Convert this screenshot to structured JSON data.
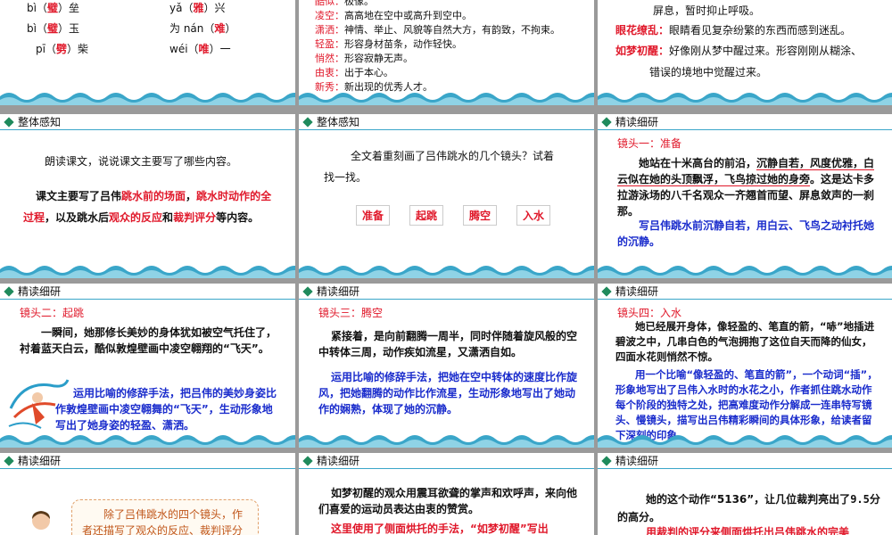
{
  "s1": {
    "rows": [
      {
        "py": "bì",
        "ch": "璧",
        "tail": "垒"
      },
      {
        "py": "bì",
        "ch": "璧",
        "tail": "玉"
      },
      {
        "py": "pī",
        "ch": "劈",
        "tail": "柴"
      }
    ],
    "rows2": [
      {
        "py": "yǎ",
        "ch": "雅",
        "tail": "兴"
      },
      {
        "py": "为 nán",
        "ch": "难",
        "tail": ""
      },
      {
        "py": "wéi",
        "ch": "唯",
        "tail": "一"
      }
    ]
  },
  "s2": {
    "items": [
      {
        "k": "酷似：",
        "v": "极像。"
      },
      {
        "k": "凌空：",
        "v": "高高地在空中或高升到空中。"
      },
      {
        "k": "潇洒：",
        "v": "神情、举止、风貌等自然大方，有韵致，不拘束。"
      },
      {
        "k": "轻盈：",
        "v": "形容身材苗条，动作轻快。"
      },
      {
        "k": "悄然：",
        "v": "形容寂静无声。"
      },
      {
        "k": "由衷：",
        "v": "出于本心。"
      },
      {
        "k": "新秀：",
        "v": "新出现的优秀人才。"
      }
    ]
  },
  "s3": {
    "line0": "屏息，暂时抑止呼吸。",
    "items": [
      {
        "k": "眼花缭乱：",
        "v": "眼睛看见复杂纷繁的东西而感到迷乱。"
      },
      {
        "k": "如梦初醒：",
        "v": "好像刚从梦中醒过来。形容刚刚从糊涂、"
      }
    ],
    "line_last": "错误的境地中觉醒过来。"
  },
  "s4": {
    "header": "整体感知",
    "q": "朗读课文，说说课文主要写了哪些内容。",
    "a_parts": [
      "课文主要写了吕伟",
      "跳水前的场面",
      "，",
      "跳水时动作",
      "的全过程",
      "，以及跳水后",
      "观众的反应",
      "和",
      "裁判评分",
      "等内容。"
    ]
  },
  "s5": {
    "header": "整体感知",
    "q1": "全文着重刻画了吕伟跳水的几个镜头？试着",
    "q2": "找一找。",
    "boxes": [
      "准备",
      "起跳",
      "腾空",
      "入水"
    ]
  },
  "s6": {
    "header": "精读细研",
    "label": "镜头一：准备",
    "p1": "她站在十米高台的前沿，",
    "p1u": "沉静自若，风度优雅，白云似在她的头顶飘浮，飞鸟掠过她的身旁",
    "p1b": "。这是达卡多拉游泳场的八千名观众一齐翘首而望、屏息敛声的一刹那。",
    "a": "写吕伟跳水前沉静自若，用白云、飞鸟之动衬托她的沉静。"
  },
  "s7": {
    "header": "精读细研",
    "label": "镜头二：起跳",
    "p": "一瞬间，她那修长美妙的身体犹如被空气托住了，衬着蓝天白云，酷似敦煌壁画中凌空翱翔的“飞天”。",
    "a": "运用比喻的修辞手法，把吕伟的美妙身姿比作敦煌壁画中凌空翱舞的“飞天”，生动形象地写出了她身姿的轻盈、潇洒。"
  },
  "s8": {
    "header": "精读细研",
    "label": "镜头三：腾空",
    "p": "紧接着，是向前翻腾一周半，同时伴随着旋风般的空中转体三周，动作疾如流星，又潇洒自如。",
    "a": "运用比喻的修辞手法，把她在空中转体的速度比作旋风，把她翻腾的动作比作流星，生动形象地写出了她动作的娴熟，体现了她的沉静。"
  },
  "s9": {
    "header": "精读细研",
    "label": "镜头四：入水",
    "p": "她已经展开身体，像轻盈的、笔直的箭，“哧”地插进碧波之中，几串白色的气泡拥抱了这位自天而降的仙女，四面水花则悄然不惊。",
    "a": "用一个比喻“像轻盈的、笔直的箭”，一个动词“插”，形象地写出了吕伟入水时的水花之小，作者抓住跳水动作每个阶段的独特之处，把高难度动作分解成一连串特写镜头、慢镜头，描写出吕伟精彩瞬间的具体形象，给读者留下深刻的印象。"
  },
  "s10": {
    "header": "精读细研",
    "note": "除了吕伟跳水的四个镜头，作者还描写了观众的反应、裁判评分"
  },
  "s11": {
    "header": "精读细研",
    "p": "如梦初醒的观众用震耳欲聋的掌声和欢呼声，来向他们喜爱的运动员表达由衷的赞赏。",
    "a": "这里使用了侧面烘托的手法，“如梦初醒”写出"
  },
  "s12": {
    "header": "精读细研",
    "p1": "她的这个动作“5136”，让几位裁判亮出了",
    "score": "9.5",
    "p2": "分的高分。",
    "a": "用裁判的评分来侧面烘托出吕伟跳水的完美"
  }
}
